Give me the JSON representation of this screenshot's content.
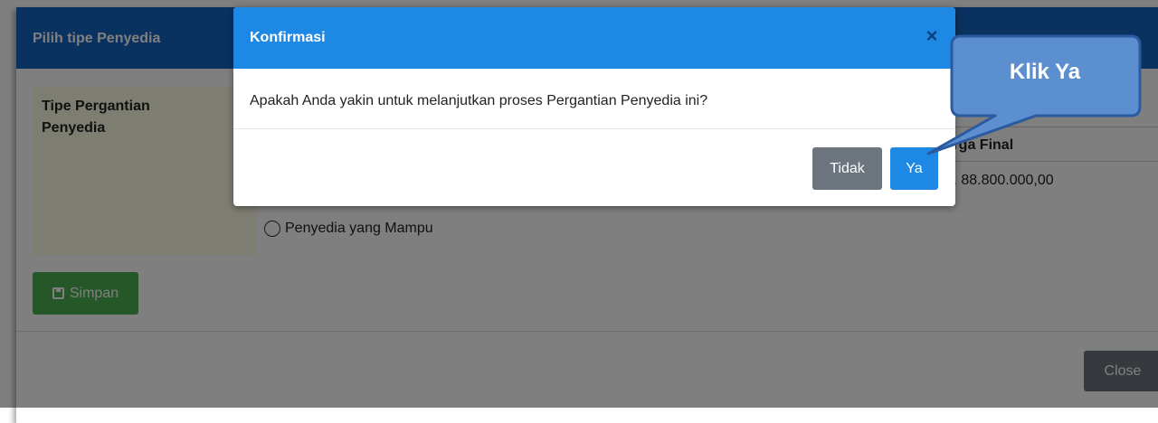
{
  "background_modal": {
    "title": "Pilih tipe Penyedia",
    "tipe_label": "Tipe Pergantian Penyedia",
    "radio_option": "Penyedia yang Mampu",
    "harga_header": "Harga Final",
    "harga_value": "Rp. 88.800.000,00",
    "simpan_label": "Simpan",
    "close_label": "Close"
  },
  "dialog": {
    "title": "Konfirmasi",
    "close_symbol": "×",
    "message": "Apakah Anda yakin untuk melanjutkan proses Pergantian Penyedia ini?",
    "no_label": "Tidak",
    "yes_label": "Ya"
  },
  "annotation": {
    "text": "Klik Ya"
  },
  "colors": {
    "header_dark_blue": "#1565c0",
    "dialog_blue": "#1e88e5",
    "save_green": "#4caf50",
    "secondary_gray": "#6c757d",
    "callout_fill": "#5b8fd0",
    "callout_border": "#2c5aa0"
  }
}
